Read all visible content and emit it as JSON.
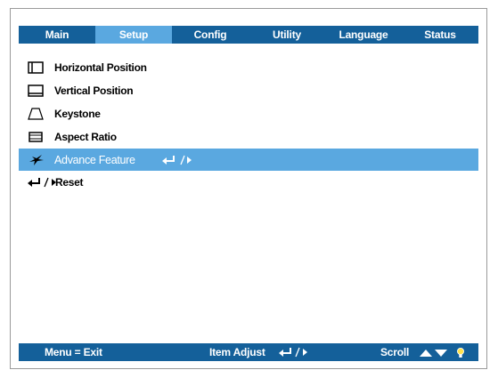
{
  "tabs": [
    {
      "label": "Main"
    },
    {
      "label": "Setup"
    },
    {
      "label": "Config"
    },
    {
      "label": "Utility"
    },
    {
      "label": "Language"
    },
    {
      "label": "Status"
    }
  ],
  "active_tab": "Setup",
  "menu": {
    "items": [
      {
        "label": "Horizontal Position",
        "icon": "horizontal-position-icon"
      },
      {
        "label": "Vertical Position",
        "icon": "vertical-position-icon"
      },
      {
        "label": "Keystone",
        "icon": "keystone-icon"
      },
      {
        "label": "Aspect Ratio",
        "icon": "aspect-ratio-icon"
      },
      {
        "label": "Advance Feature",
        "icon": "star-icon",
        "selected": true
      },
      {
        "label": "Reset",
        "icon": "enter-arrow-icon"
      }
    ]
  },
  "status": {
    "exit": "Menu = Exit",
    "adjust": "Item Adjust",
    "scroll": "Scroll"
  },
  "colors": {
    "bar": "#14609a",
    "highlight": "#5aa8e0"
  }
}
